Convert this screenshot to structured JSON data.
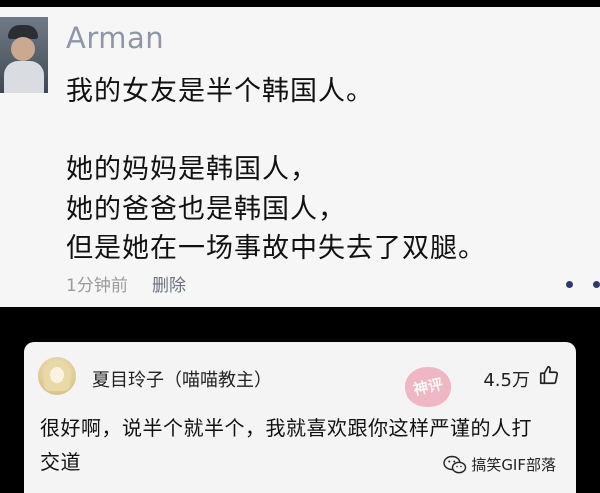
{
  "post": {
    "author": "Arman",
    "lines": [
      "我的女友是半个韩国人。",
      "她的妈妈是韩国人，",
      "她的爸爸也是韩国人，",
      "但是她在一场事故中失去了双腿。"
    ],
    "time": "1分钟前",
    "delete_label": "删除",
    "more_icon": "more-dots-icon",
    "accent_color": "#2f3a6b"
  },
  "comment": {
    "author": "夏目玲子（喵喵教主）",
    "likes": "4.5万",
    "like_icon": "thumb-up-icon",
    "text_lines": [
      "很好啊，说半个就半个，我就喜欢跟你这样严谨的人打",
      "交道"
    ],
    "stamp_text": "神评",
    "stamp_color": "#e8476a"
  },
  "watermark": {
    "icon": "wechat-icon",
    "label": "搞笑GIF部落"
  }
}
